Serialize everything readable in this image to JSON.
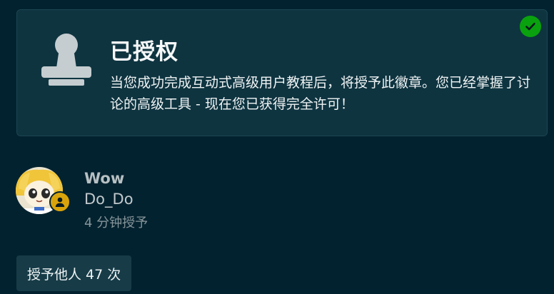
{
  "badge": {
    "title": "已授权",
    "description": "当您成功完成互动式高级用户教程后，将授予此徽章。您已经掌握了讨论的高级工具 - 现在您已获得完全许可！",
    "icon": "stamp-icon",
    "status_icon": "checkmark-icon",
    "colors": {
      "card_bg": "#0e3440",
      "check": "#0aa10f"
    }
  },
  "grant": {
    "user_name": "Wow",
    "user_handle": "Do_Do",
    "time": "4 分钟授予",
    "flair_icon": "user-icon"
  },
  "others": {
    "label": "授予他人 47 次"
  }
}
